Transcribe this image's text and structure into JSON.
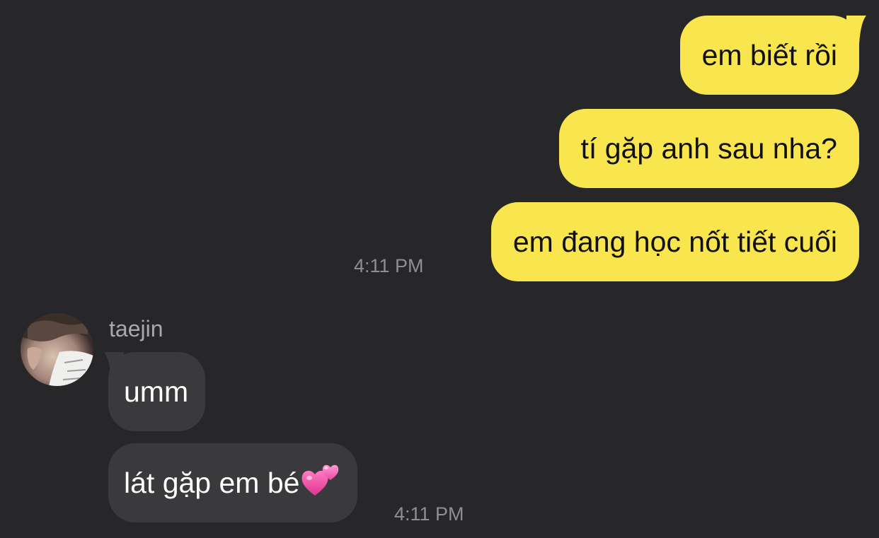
{
  "conversation": {
    "outgoing_messages": [
      {
        "text": "em biết rồi"
      },
      {
        "text": "tí gặp anh sau nha?"
      },
      {
        "text": "em đang học nốt tiết cuối"
      }
    ],
    "outgoing_time": "4:11 PM",
    "incoming": {
      "sender_name": "taejin",
      "messages": [
        {
          "text": "umm"
        },
        {
          "text": "lát gặp em bé"
        }
      ],
      "time": "4:11 PM"
    }
  },
  "icons": {
    "emoji": "two-hearts-icon",
    "avatar": "avatar"
  },
  "colors": {
    "background": "#272729",
    "outgoing_bubble": "#f9e54e",
    "incoming_bubble": "#3a3a3c",
    "timestamp": "#8e8e93"
  }
}
